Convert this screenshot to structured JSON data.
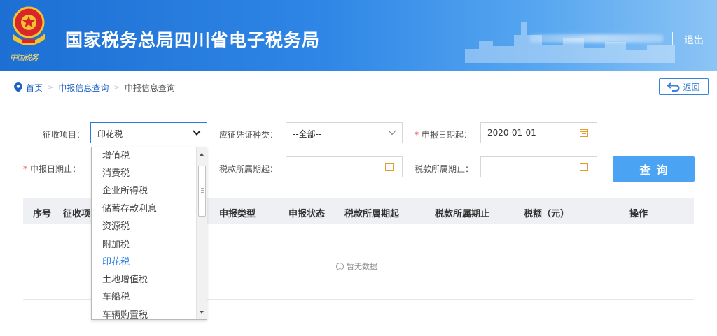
{
  "header": {
    "site_title": "国家税务总局四川省电子税务局",
    "emblem_caption": "中国税务",
    "logout_label": "退出",
    "brand_color": "#2f86e6"
  },
  "breadcrumb": {
    "items": [
      "首页",
      "申报信息查询",
      "申报信息查询"
    ]
  },
  "back_button": {
    "label": "返回"
  },
  "form": {
    "tax_item": {
      "label": "征收项目：",
      "value": "印花税"
    },
    "voucher_type": {
      "label": "应征凭证种类：",
      "value": "--全部--"
    },
    "declare_date_start": {
      "label": "申报日期起：",
      "value": "2020-01-01",
      "required": true
    },
    "declare_date_end": {
      "label": "申报日期止：",
      "value": "",
      "required": true
    },
    "period_start": {
      "label": "税款所属期起：",
      "value": ""
    },
    "period_end": {
      "label": "税款所属期止：",
      "value": ""
    },
    "query_button": "查询"
  },
  "dropdown": {
    "options": [
      "增值税",
      "消费税",
      "企业所得税",
      "储蓄存款利息",
      "资源税",
      "附加税",
      "印花税",
      "土地增值税",
      "车船税",
      "车辆购置税"
    ],
    "selected": "印花税",
    "highlight_color": "#2a7de1"
  },
  "table": {
    "columns": [
      "序号",
      "征收项",
      "申报类型",
      "申报状态",
      "税款所属期起",
      "税款所属期止",
      "税额（元）",
      "操作"
    ],
    "empty_text": "暂无数据"
  },
  "colors": {
    "query_button": "#4aa3f3",
    "link": "#1b62c2",
    "required": "#e33333"
  }
}
